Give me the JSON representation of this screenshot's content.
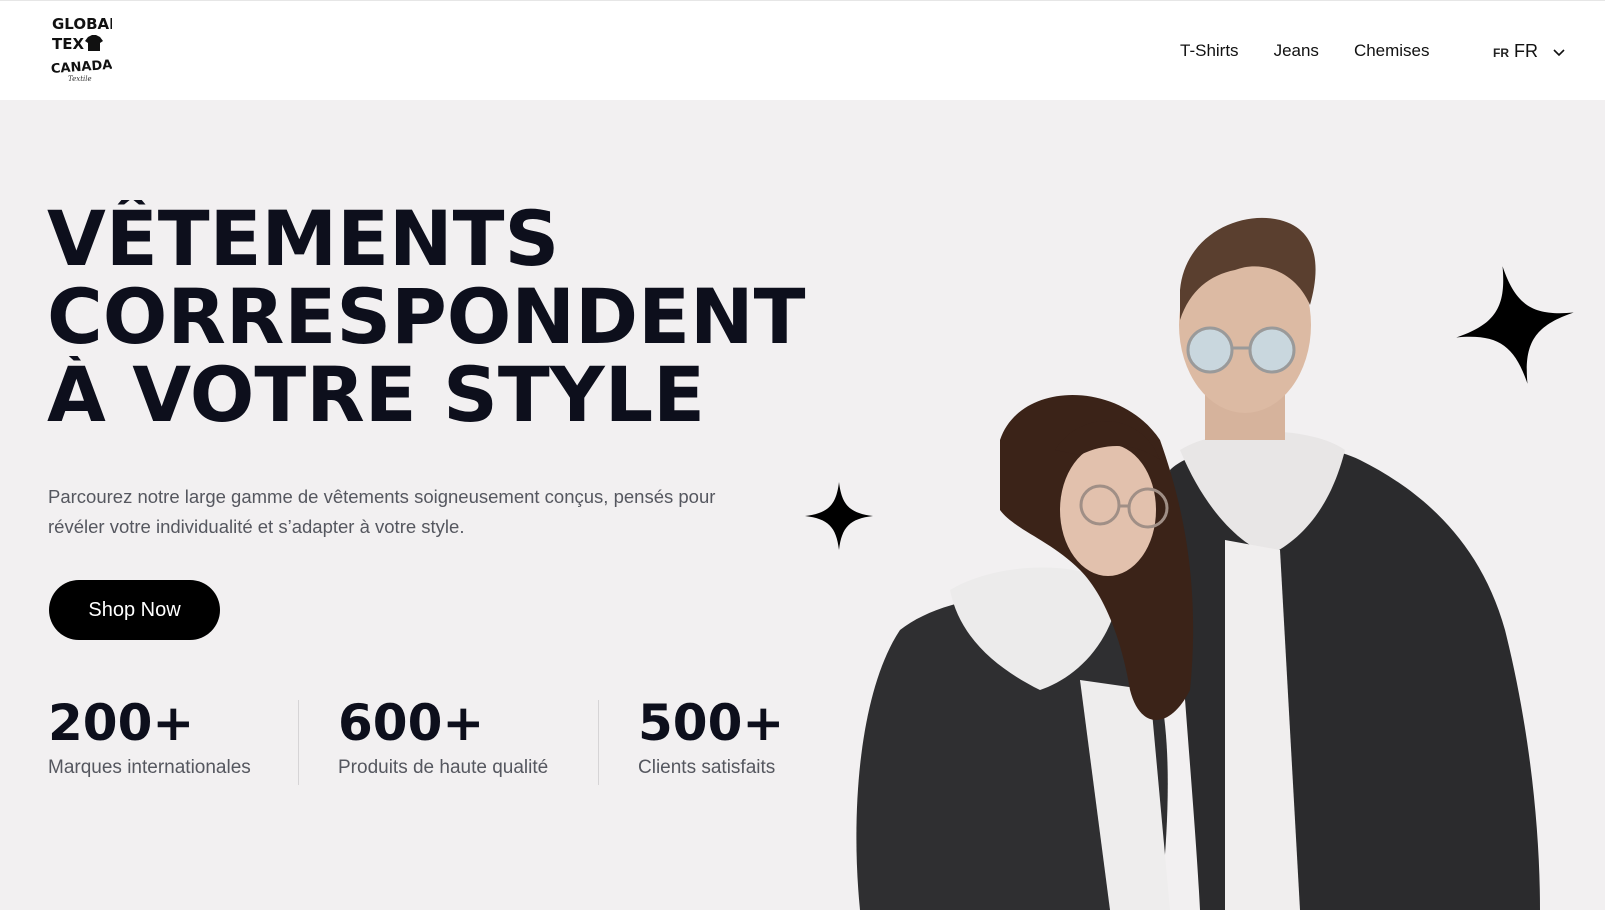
{
  "header": {
    "logo_text": [
      "GLOBAL",
      "TEX",
      "CANADA",
      "Textile"
    ],
    "nav": [
      {
        "label": "T-Shirts"
      },
      {
        "label": "Jeans"
      },
      {
        "label": "Chemises"
      }
    ],
    "language": {
      "code_small": "FR",
      "code": "FR",
      "icon": "chevron-down-icon"
    }
  },
  "hero": {
    "title_lines": [
      "VÊTEMENTS",
      "CORRESPONDENT",
      "À VOTRE STYLE"
    ],
    "description": "Parcourez notre large gamme de vêtements soigneusement conçus, pensés pour révéler votre individualité et s’adapter à votre style.",
    "cta_label": "Shop Now",
    "stats": [
      {
        "value": "200+",
        "label": "Marques internationales"
      },
      {
        "value": "600+",
        "label": "Produits de haute qualité"
      },
      {
        "value": "500+",
        "label": "Clients satisfaits"
      }
    ]
  },
  "colors": {
    "background": "#f2f0f1",
    "header_bg": "#ffffff",
    "title": "#0d0f1c",
    "button_bg": "#000000",
    "button_text": "#ffffff",
    "muted_text": "#55575f"
  },
  "icons": [
    "sparkle-star-icon",
    "chevron-down-icon",
    "tshirt-icon"
  ]
}
